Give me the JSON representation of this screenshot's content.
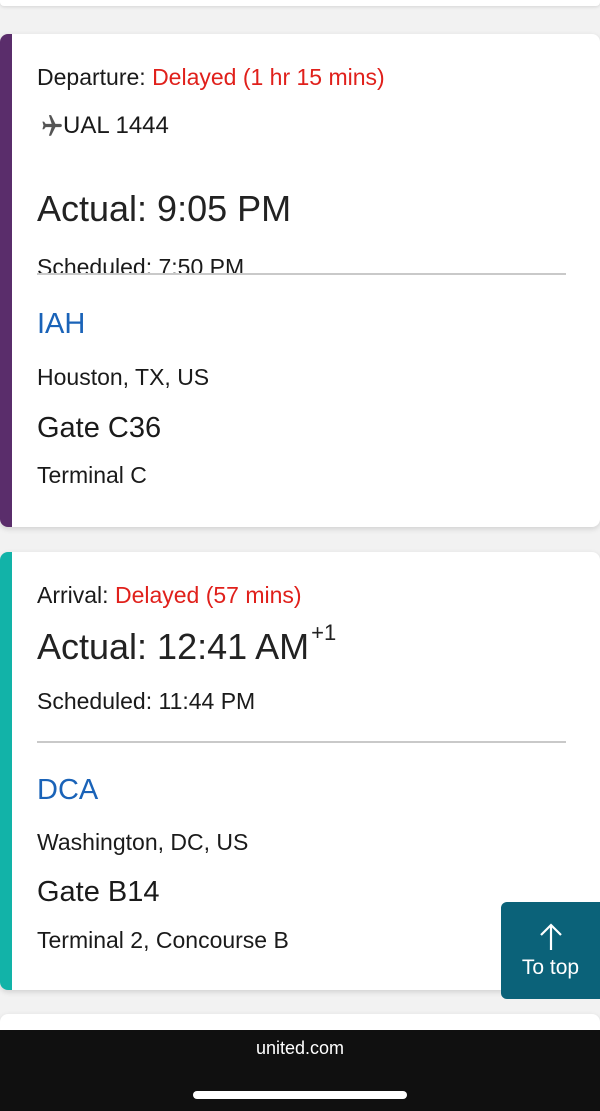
{
  "departure": {
    "status_label": "Departure:",
    "status_value": "Delayed (1 hr 15 mins)",
    "flight_number": "UAL 1444",
    "actual": "Actual: 9:05 PM",
    "scheduled": "Scheduled: 7:50 PM",
    "airport_code": "IAH",
    "city": "Houston, TX, US",
    "gate": "Gate C36",
    "terminal": "Terminal C",
    "accent_color": "#5a2d6b"
  },
  "arrival": {
    "status_label": "Arrival:",
    "status_value": "Delayed (57 mins)",
    "actual": "Actual: 12:41 AM",
    "day_offset": "+1",
    "scheduled": "Scheduled: 11:44 PM",
    "airport_code": "DCA",
    "city": "Washington, DC, US",
    "gate": "Gate B14",
    "terminal": "Terminal 2, Concourse B",
    "accent_color": "#12b3a8"
  },
  "to_top_button": {
    "label": "To top",
    "icon": "arrow-up-icon"
  },
  "browser": {
    "domain": "united.com"
  },
  "colors": {
    "delay_red": "#e0201b",
    "airport_blue": "#1a63b8",
    "to_top_bg": "#0b6279"
  }
}
